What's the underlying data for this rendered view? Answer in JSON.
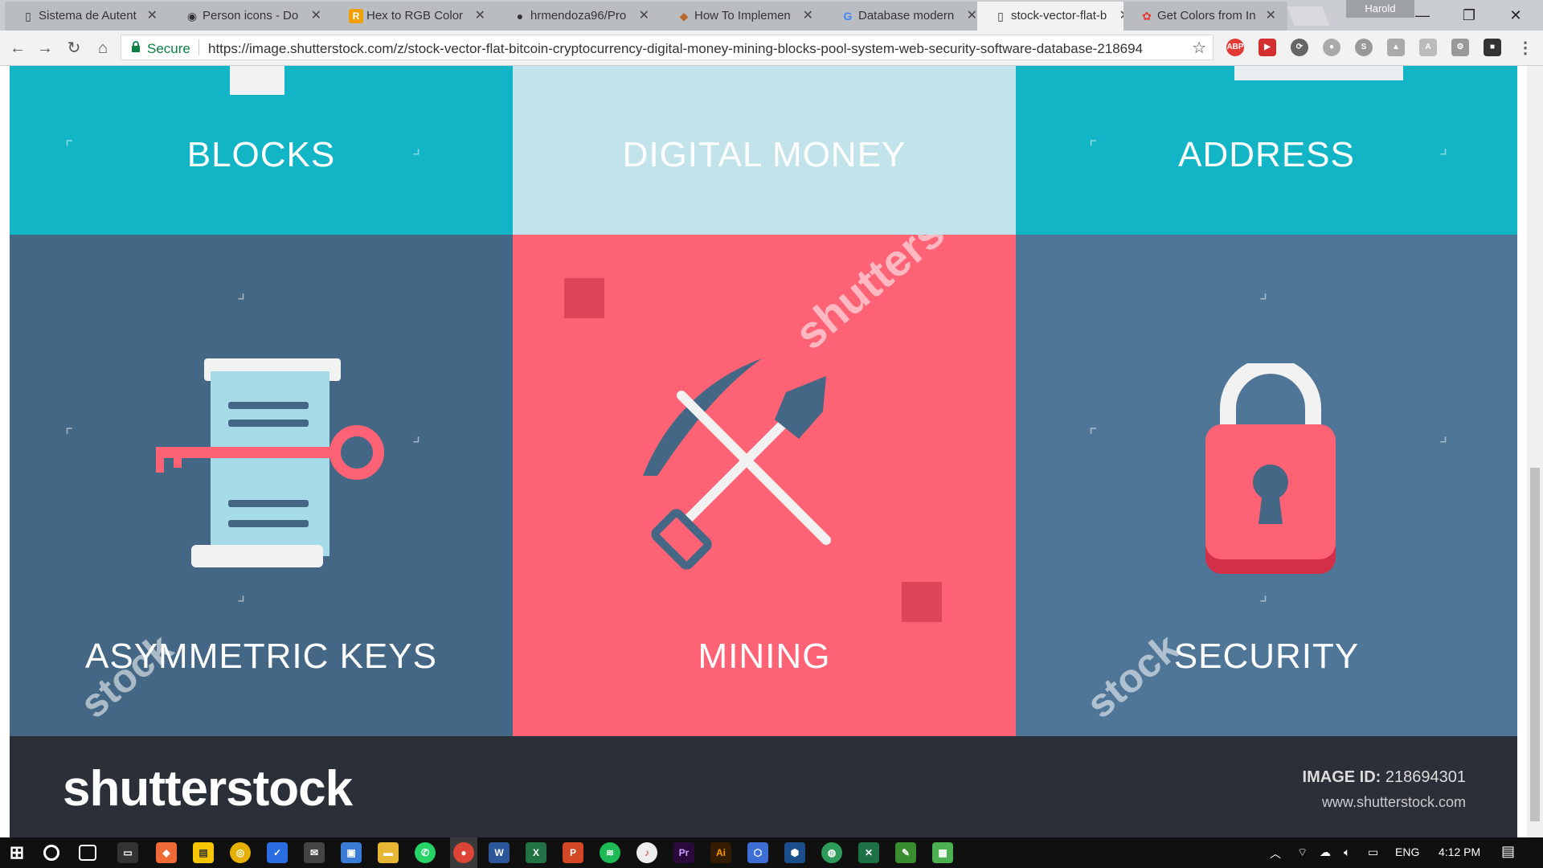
{
  "browser": {
    "tabs": [
      {
        "title": "Sistema de Autent",
        "icon": "page-icon"
      },
      {
        "title": "Person icons - Do",
        "icon": "eye-icon"
      },
      {
        "title": "Hex to RGB Color",
        "icon": "r-logo-icon"
      },
      {
        "title": "hrmendoza96/Pro",
        "icon": "github-icon"
      },
      {
        "title": "How To Implemen",
        "icon": "hand-icon"
      },
      {
        "title": "Database modern",
        "icon": "google-icon"
      },
      {
        "title": "stock-vector-flat-b",
        "icon": "page-icon"
      },
      {
        "title": "Get Colors from In",
        "icon": "color-wheel-icon"
      }
    ],
    "profile": "Harold",
    "secure_label": "Secure",
    "url": "https://image.shutterstock.com/z/stock-vector-flat-bitcoin-cryptocurrency-digital-money-mining-blocks-pool-system-web-security-software-database-218694"
  },
  "image": {
    "cells": {
      "blocks": "BLOCKS",
      "digital_money": "DIGITAL MONEY",
      "address": "ADDRESS",
      "asymmetric_keys": "ASYMMETRIC KEYS",
      "mining": "MINING",
      "security": "SECURITY"
    },
    "watermark": "shutterstock",
    "watermark_short": "stock"
  },
  "footer": {
    "logo": "shutterstock",
    "image_id_label": "IMAGE ID:",
    "image_id": "218694301",
    "site": "www.shutterstock.com"
  },
  "taskbar": {
    "lang": "ENG",
    "time": "4:12 PM"
  },
  "colors": {
    "teal": "#11b5c6",
    "light_blue": "#c3e3ea",
    "slate": "#436784",
    "slate_alt": "#4f7597",
    "coral": "#fd6275",
    "dark": "#2b2f38"
  }
}
